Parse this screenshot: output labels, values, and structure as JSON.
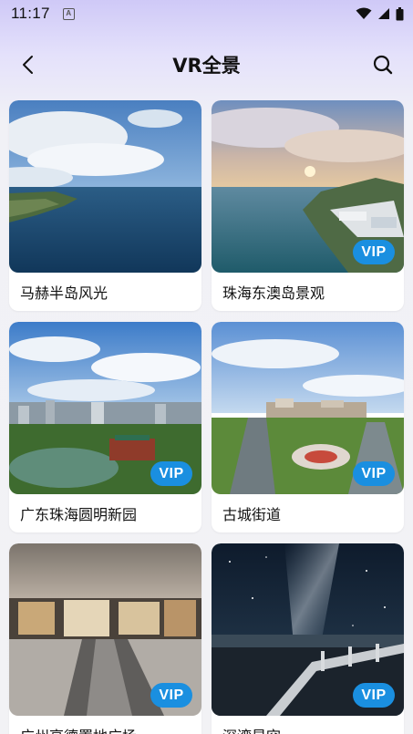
{
  "status_bar": {
    "time": "11:17",
    "notification_letter": "A"
  },
  "header": {
    "title": "VR全景",
    "back_icon": "chevron-left-icon",
    "search_icon": "search-icon"
  },
  "cards": [
    {
      "title": "马赫半岛风光",
      "vip": false,
      "vip_label": ""
    },
    {
      "title": "珠海东澳岛景观",
      "vip": true,
      "vip_label": "VIP"
    },
    {
      "title": "广东珠海圆明新园",
      "vip": true,
      "vip_label": "VIP"
    },
    {
      "title": "古城街道",
      "vip": true,
      "vip_label": "VIP"
    },
    {
      "title": "广州高德置地广场",
      "vip": true,
      "vip_label": "VIP"
    },
    {
      "title": "深湾星空",
      "vip": true,
      "vip_label": "VIP"
    }
  ]
}
